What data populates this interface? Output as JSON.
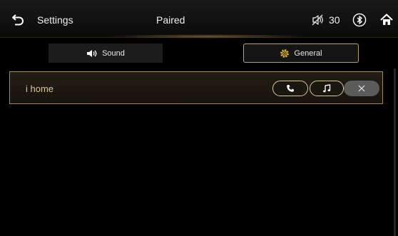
{
  "header": {
    "title": "Settings",
    "center_title": "Paired",
    "volume": "30",
    "icons": [
      "back-arrow-icon",
      "mute-icon",
      "bluetooth-icon",
      "home-icon"
    ]
  },
  "tabs": [
    {
      "label": "Sound",
      "icon": "speaker-icon",
      "selected": false
    },
    {
      "label": "General",
      "icon": "gear-icon",
      "selected": true
    }
  ],
  "devices": [
    {
      "name": "i home",
      "actions": [
        "phone-icon",
        "music-note-icon",
        "close-icon"
      ]
    }
  ],
  "colors": {
    "accent": "#d9c59a",
    "border": "#9c8760",
    "background": "#000000"
  }
}
